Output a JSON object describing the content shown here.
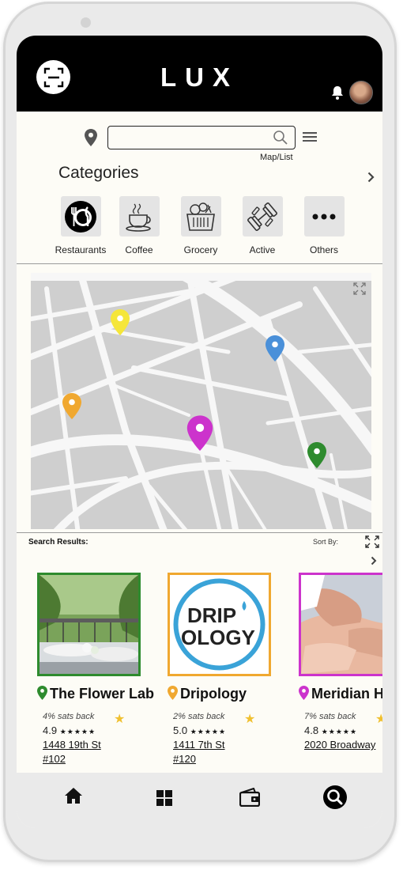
{
  "app": {
    "logo": "LUX"
  },
  "header": {
    "scan_icon": "scan-icon",
    "bell_icon": "bell-icon"
  },
  "search": {
    "value": "",
    "placeholder": "",
    "map_list_label": "Map/List"
  },
  "categories": {
    "title": "Categories",
    "items": [
      {
        "label": "Restaurants",
        "icon": "utensils-icon"
      },
      {
        "label": "Coffee",
        "icon": "coffee-cup-icon"
      },
      {
        "label": "Grocery",
        "icon": "grocery-basket-icon"
      },
      {
        "label": "Active",
        "icon": "dumbbell-icon"
      },
      {
        "label": "Others",
        "icon": "more-dots-icon"
      }
    ]
  },
  "map": {
    "pins": [
      {
        "color": "#f5e63a"
      },
      {
        "color": "#4a90d9"
      },
      {
        "color": "#f0a830"
      },
      {
        "color": "#cc33cc"
      },
      {
        "color": "#2e8b2e"
      }
    ]
  },
  "results": {
    "title": "Search Results:",
    "sort_label": "Sort By:",
    "cards": [
      {
        "name": "The Flower Lab",
        "pin_color": "#2e8b2e",
        "border_color": "#2e8b2e",
        "sats": "4% sats back",
        "rating": "4.9",
        "stars": "★★★★★",
        "addr1": "1448 19th St",
        "addr2": "#102"
      },
      {
        "name": "Dripology",
        "pin_color": "#f0a830",
        "border_color": "#f0a830",
        "sats": "2% sats back",
        "rating": "5.0",
        "stars": "★★★★★",
        "addr1": "1411 7th St",
        "addr2": "#120",
        "logo_line1": "DRIP",
        "logo_line2": "OLOGY"
      },
      {
        "name": "Meridian He",
        "pin_color": "#cc33cc",
        "border_color": "#cc33cc",
        "sats": "7% sats back",
        "rating": "4.8",
        "stars": "★★★★★",
        "addr1": "2020 Broadway",
        "addr2": ""
      }
    ]
  },
  "nav": {
    "items": [
      {
        "icon": "home-icon"
      },
      {
        "icon": "grid-icon"
      },
      {
        "icon": "wallet-icon"
      },
      {
        "icon": "search-icon"
      }
    ]
  }
}
